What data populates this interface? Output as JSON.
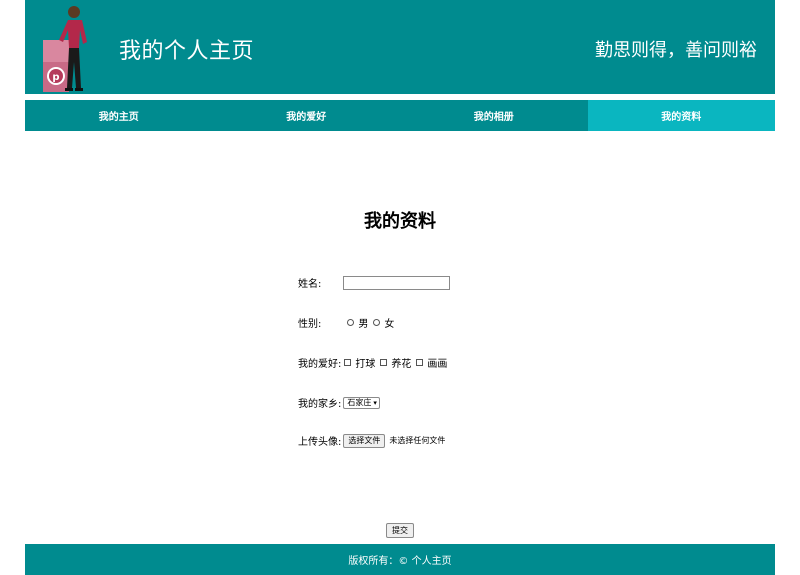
{
  "header": {
    "title": "我的个人主页",
    "motto": "勤思则得，善问则裕",
    "logo_icon": "person-with-pinterest-sign-icon"
  },
  "nav": {
    "items": [
      {
        "label": "我的主页"
      },
      {
        "label": "我的爱好"
      },
      {
        "label": "我的相册"
      },
      {
        "label": "我的资料",
        "active": true
      }
    ]
  },
  "main": {
    "title": "我的资料",
    "form": {
      "name_label": "姓名:",
      "name_value": "",
      "gender_label": "性别:",
      "gender_options": [
        "男",
        "女"
      ],
      "hobby_label": "我的爱好:",
      "hobby_options": [
        "打球",
        "养花",
        "画画"
      ],
      "hometown_label": "我的家乡:",
      "hometown_selected": "石家庄",
      "avatar_label": "上传头像:",
      "file_button": "选择文件",
      "file_status": "未选择任何文件",
      "submit": "提交"
    }
  },
  "footer": {
    "copyright": "版权所有：© 个人主页"
  },
  "colors": {
    "primary": "#008b8f",
    "active_tab": "#0ab6c0"
  }
}
